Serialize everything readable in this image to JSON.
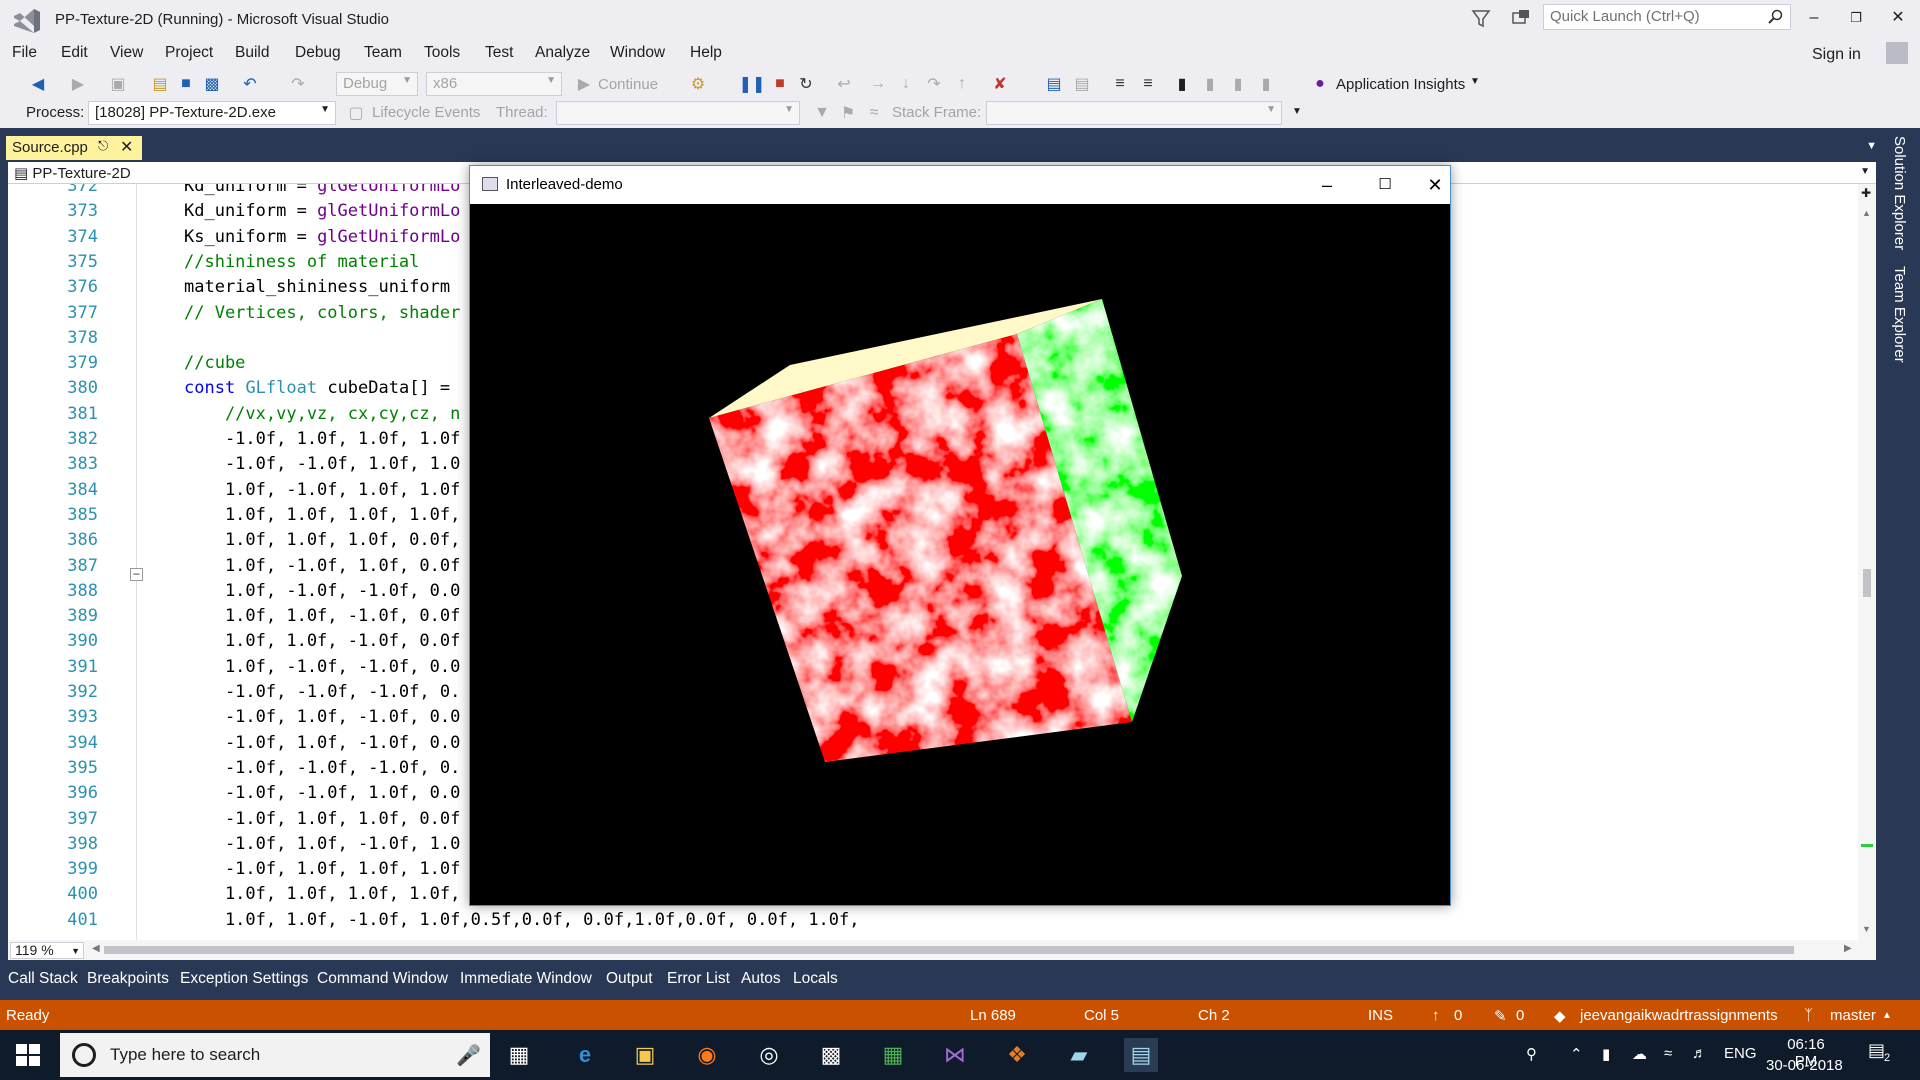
{
  "window": {
    "title": "PP-Texture-2D (Running) - Microsoft Visual Studio",
    "quick_launch_placeholder": "Quick Launch (Ctrl+Q)",
    "sign_in": "Sign in"
  },
  "menu": [
    "File",
    "Edit",
    "View",
    "Project",
    "Build",
    "Debug",
    "Team",
    "Tools",
    "Test",
    "Analyze",
    "Window",
    "Help"
  ],
  "toolbar": {
    "config": "Debug",
    "platform": "x86",
    "continue": "Continue",
    "app_insights": "Application Insights",
    "process_label": "Process:",
    "process_value": "[18028] PP-Texture-2D.exe",
    "lifecycle": "Lifecycle Events",
    "thread_label": "Thread:",
    "stack_frame_label": "Stack Frame:"
  },
  "editor": {
    "tab": "Source.cpp",
    "nav_project": "PP-Texture-2D",
    "zoom": "119 %",
    "lines": [
      {
        "n": "372",
        "t": "Kd_uniform = glGetUniformLo"
      },
      {
        "n": "373",
        "t": "Kd_uniform = glGetUniformLo"
      },
      {
        "n": "374",
        "t": "Ks_uniform = glGetUniformLo"
      },
      {
        "n": "375",
        "t": "//shininess of material"
      },
      {
        "n": "376",
        "t": "material_shininess_uniform"
      },
      {
        "n": "377",
        "t": "// Vertices, colors, shader"
      },
      {
        "n": "378",
        "t": ""
      },
      {
        "n": "379",
        "t": "//cube"
      },
      {
        "n": "380",
        "t": "const GLfloat cubeData[] ="
      },
      {
        "n": "381",
        "t": "    //vx,vy,vz, cx,cy,cz, n"
      },
      {
        "n": "382",
        "t": "    -1.0f, 1.0f, 1.0f, 1.0f"
      },
      {
        "n": "383",
        "t": "    -1.0f, -1.0f, 1.0f, 1.0"
      },
      {
        "n": "384",
        "t": "    1.0f, -1.0f, 1.0f, 1.0f"
      },
      {
        "n": "385",
        "t": "    1.0f, 1.0f, 1.0f, 1.0f,"
      },
      {
        "n": "386",
        "t": "    1.0f, 1.0f, 1.0f, 0.0f,"
      },
      {
        "n": "387",
        "t": "    1.0f, -1.0f, 1.0f, 0.0f"
      },
      {
        "n": "388",
        "t": "    1.0f, -1.0f, -1.0f, 0.0"
      },
      {
        "n": "389",
        "t": "    1.0f, 1.0f, -1.0f, 0.0f"
      },
      {
        "n": "390",
        "t": "    1.0f, 1.0f, -1.0f, 0.0f"
      },
      {
        "n": "391",
        "t": "    1.0f, -1.0f, -1.0f, 0.0"
      },
      {
        "n": "392",
        "t": "    -1.0f, -1.0f, -1.0f, 0."
      },
      {
        "n": "393",
        "t": "    -1.0f, 1.0f, -1.0f, 0.0"
      },
      {
        "n": "394",
        "t": "    -1.0f, 1.0f, -1.0f, 0.0"
      },
      {
        "n": "395",
        "t": "    -1.0f, -1.0f, -1.0f, 0."
      },
      {
        "n": "396",
        "t": "    -1.0f, -1.0f, 1.0f, 0.0"
      },
      {
        "n": "397",
        "t": "    -1.0f, 1.0f, 1.0f, 0.0f"
      },
      {
        "n": "398",
        "t": "    -1.0f, 1.0f, -1.0f, 1.0"
      },
      {
        "n": "399",
        "t": "    -1.0f, 1.0f, 1.0f, 1.0f"
      },
      {
        "n": "400",
        "t": "    1.0f, 1.0f, 1.0f, 1.0f,"
      },
      {
        "n": "401",
        "t": "    1.0f, 1.0f, -1.0f, 1.0f,0.5f,0.0f, 0.0f,1.0f,0.0f, 0.0f, 1.0f,"
      }
    ]
  },
  "right_dock": [
    "Solution Explorer",
    "Team Explorer"
  ],
  "gl_window": {
    "title": "Interleaved-demo"
  },
  "tool_windows": [
    "Call Stack",
    "Breakpoints",
    "Exception Settings",
    "Command Window",
    "Immediate Window",
    "Output",
    "Error List",
    "Autos",
    "Locals"
  ],
  "status": {
    "ready": "Ready",
    "ln": "Ln 689",
    "col": "Col 5",
    "ch": "Ch 2",
    "ins": "INS",
    "up_count": "0",
    "pen_count": "0",
    "repo": "jeevangaikwadrtrassignments",
    "branch": "master"
  },
  "taskbar": {
    "search_placeholder": "Type here to search",
    "lang": "ENG",
    "time": "06:16 PM",
    "date": "30-06-2018",
    "notifications": "2"
  },
  "colors": {
    "accent_status": "#ca5100",
    "vs_dark": "#293955",
    "tab_active": "#fff29d"
  }
}
